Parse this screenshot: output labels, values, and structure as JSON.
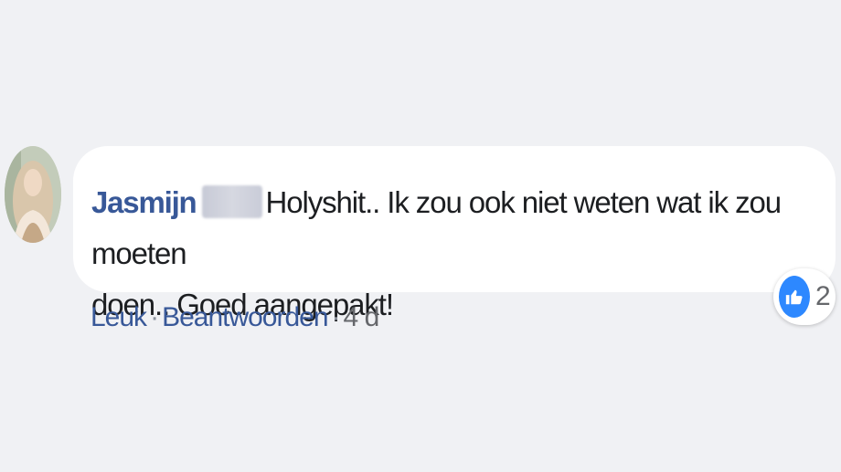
{
  "comment": {
    "author": "Jasmijn",
    "text_line1": "Holyshit.. Ik zou ook niet weten wat ik zou moeten",
    "text_line2": "doen.. Goed aangepakt!",
    "reaction_count": "2",
    "actions": {
      "like": "Leuk",
      "reply": "Beantwoorden",
      "separator": "·",
      "time": "4 d"
    }
  },
  "colors": {
    "background": "#f0f1f4",
    "bubble": "#ffffff",
    "author": "#385898",
    "text": "#1c1e21",
    "meta": "#65676b",
    "like_blue": "#2d88ff"
  },
  "icons": {
    "reaction": "thumbs-up-icon"
  }
}
